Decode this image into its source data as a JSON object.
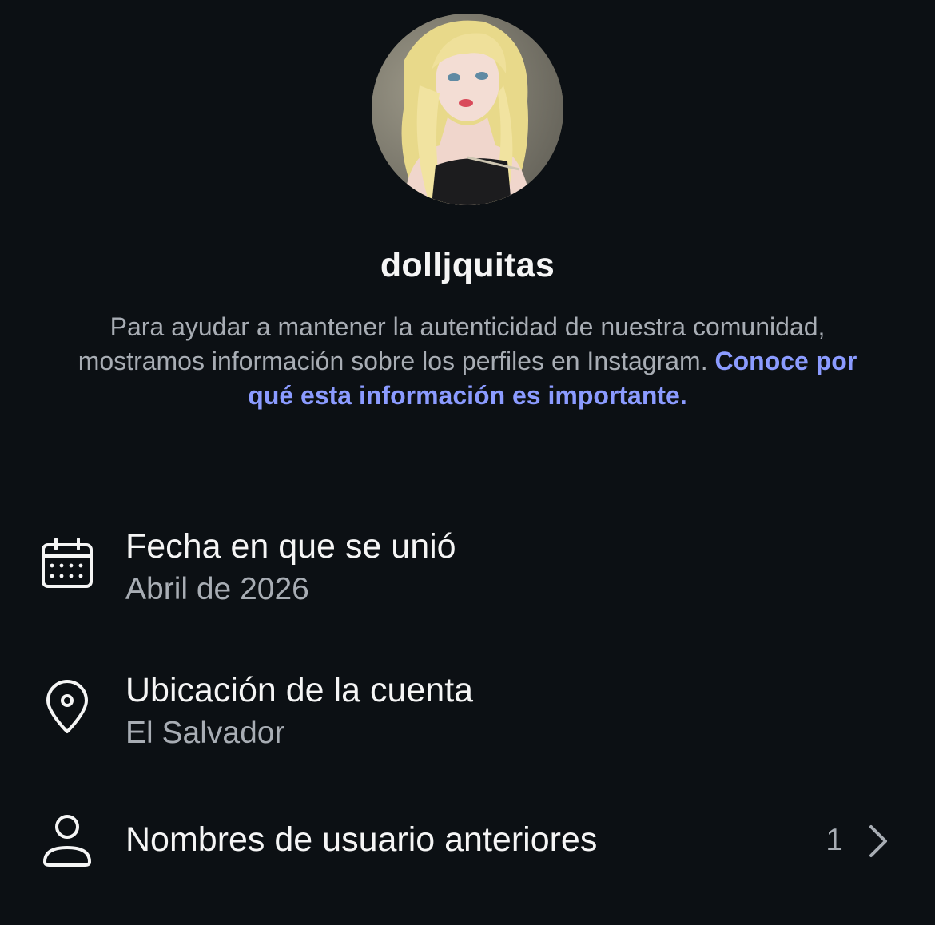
{
  "profile": {
    "username": "dolljquitas",
    "description_text": "Para ayudar a mantener la autenticidad de nuestra comunidad, mostramos información sobre los perfiles en Instagram. ",
    "description_link": "Conoce por qué esta información es importante."
  },
  "rows": [
    {
      "icon": "calendar-icon",
      "title": "Fecha en que se unió",
      "value": "Abril de 2026"
    },
    {
      "icon": "location-pin-icon",
      "title": "Ubicación de la cuenta",
      "value": "El Salvador"
    },
    {
      "icon": "person-icon",
      "title": "Nombres de usuario anteriores",
      "count": "1",
      "trailing_icon": "chevron-right-icon"
    }
  ],
  "colors": {
    "background": "#0c1014",
    "primary_text": "#f5f5f5",
    "secondary_text": "#a8adb4",
    "link": "#8b9bff"
  }
}
